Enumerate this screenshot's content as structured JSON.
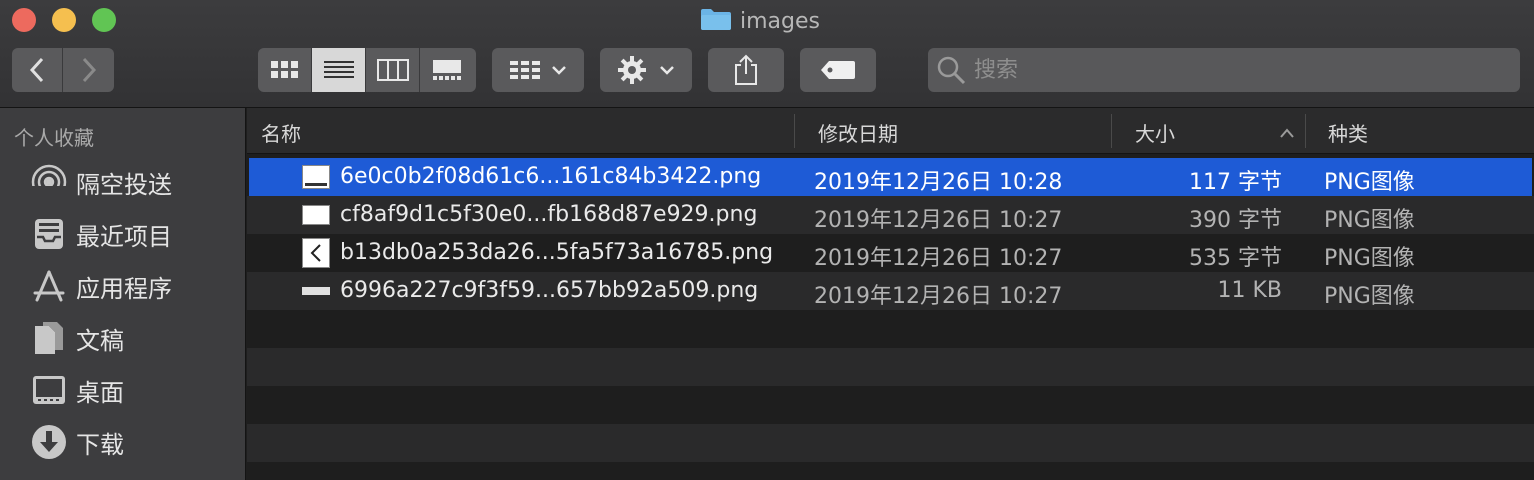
{
  "window": {
    "title": "images",
    "colors": {
      "accent": "#1e5bd6",
      "close": "#ed6a5e",
      "minimize": "#f5bf4f",
      "zoom": "#61c554",
      "folder": "#6bb4e6"
    }
  },
  "toolbar": {
    "search_placeholder": "搜索"
  },
  "sidebar": {
    "heading": "个人收藏",
    "items": [
      {
        "label": "隔空投送",
        "icon": "airdrop-icon"
      },
      {
        "label": "最近项目",
        "icon": "recents-icon"
      },
      {
        "label": "应用程序",
        "icon": "applications-icon"
      },
      {
        "label": "文稿",
        "icon": "documents-icon"
      },
      {
        "label": "桌面",
        "icon": "desktop-icon"
      },
      {
        "label": "下载",
        "icon": "downloads-icon"
      }
    ]
  },
  "list": {
    "columns": {
      "name": "名称",
      "date": "修改日期",
      "size": "大小",
      "kind": "种类"
    },
    "rows": [
      {
        "name": "6e0c0b2f08d61c6...161c84b3422.png",
        "date": "2019年12月26日 10:28",
        "size": "117 字节",
        "kind": "PNG图像",
        "selected": true
      },
      {
        "name": "cf8af9d1c5f30e0...fb168d87e929.png",
        "date": "2019年12月26日 10:27",
        "size": "390 字节",
        "kind": "PNG图像",
        "selected": false
      },
      {
        "name": "b13db0a253da26...5fa5f73a16785.png",
        "date": "2019年12月26日 10:27",
        "size": "535 字节",
        "kind": "PNG图像",
        "selected": false
      },
      {
        "name": "6996a227c9f3f59...657bb92a509.png",
        "date": "2019年12月26日 10:27",
        "size": "11 KB",
        "kind": "PNG图像",
        "selected": false
      }
    ]
  }
}
